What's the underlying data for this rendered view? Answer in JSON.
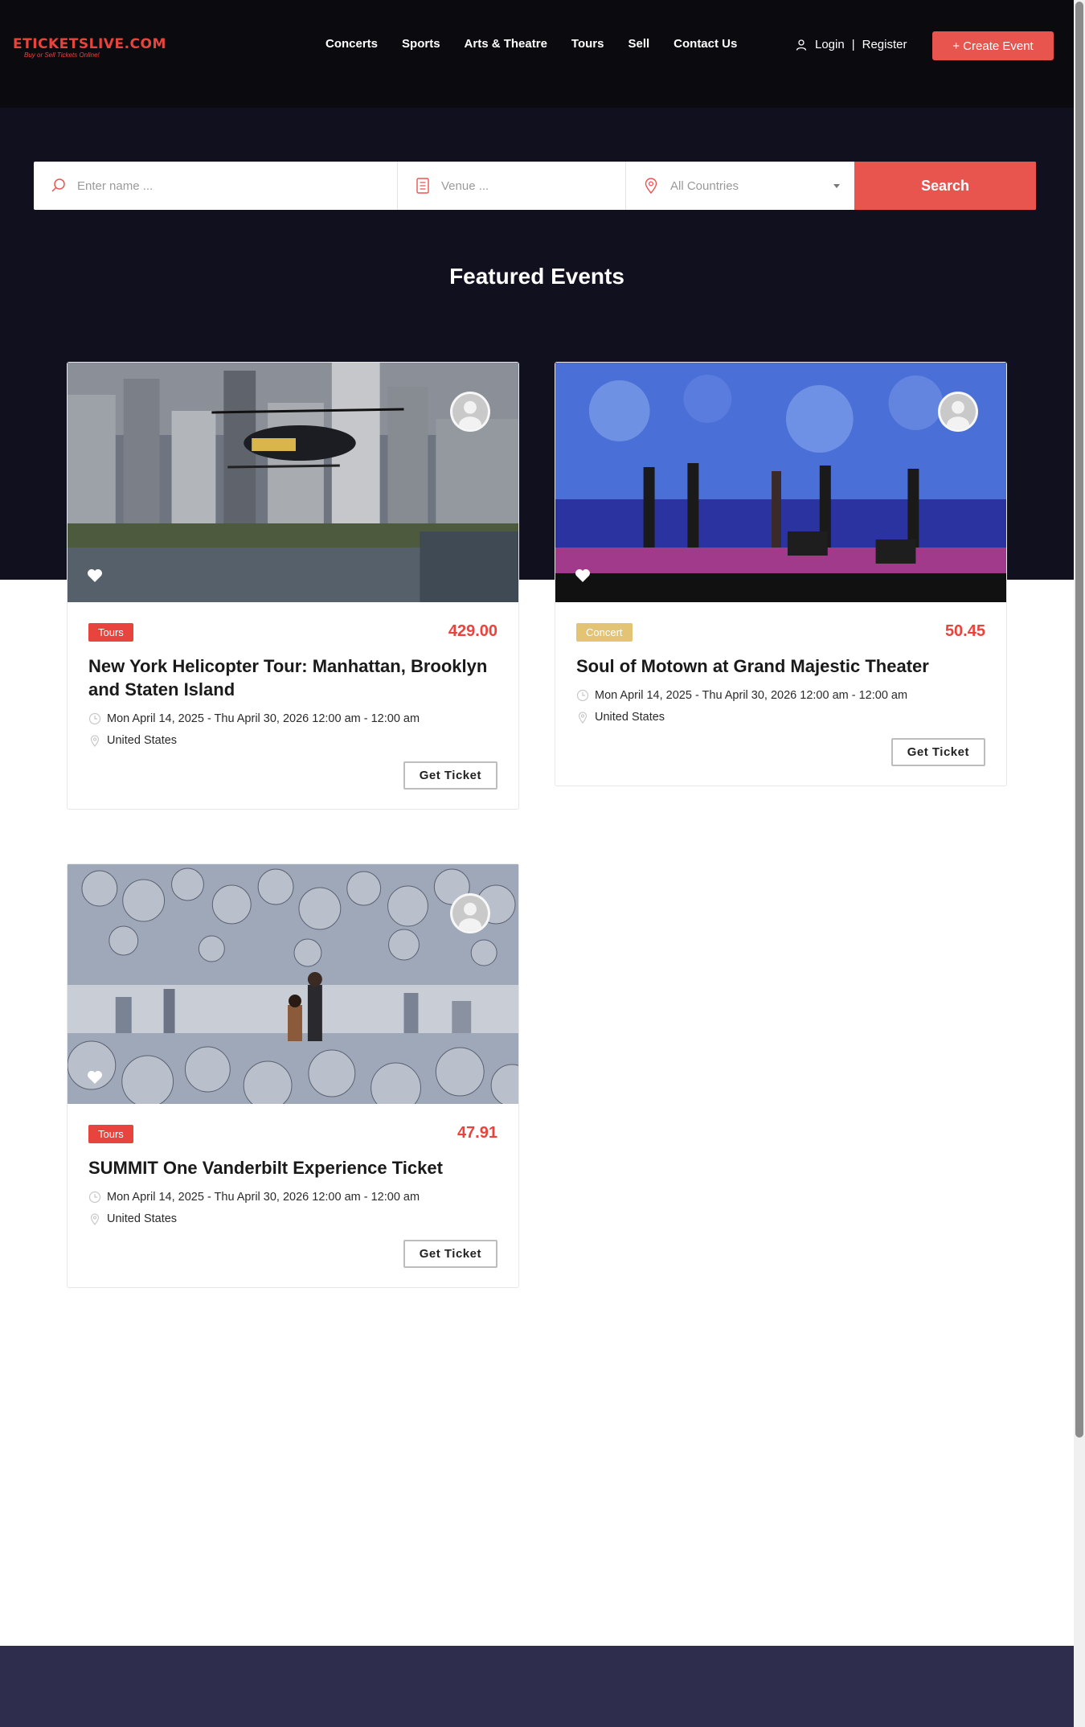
{
  "brand": {
    "name": "ETICKETSLIVE.COM",
    "tagline": "Buy or Sell Tickets Online!"
  },
  "nav": [
    "Concerts",
    "Sports",
    "Arts & Theatre",
    "Tours",
    "Sell",
    "Contact Us"
  ],
  "auth": {
    "login": "Login",
    "separator": "|",
    "register": "Register"
  },
  "create_event": "+ Create Event",
  "search": {
    "name_placeholder": "Enter name ...",
    "venue_placeholder": "Venue ...",
    "country_selected": "All Countries",
    "button": "Search"
  },
  "section_title": "Featured Events",
  "events": [
    {
      "category": "Tours",
      "price": "429.00",
      "title": "New York Helicopter Tour: Manhattan, Brooklyn and Staten Island",
      "dates": "Mon April 14, 2025 - Thu April 30, 2026 12:00 am - 12:00 am",
      "location": "United States",
      "button": "Get Ticket"
    },
    {
      "category": "Concert",
      "price": "50.45",
      "title": "Soul of Motown at Grand Majestic Theater",
      "dates": "Mon April 14, 2025 - Thu April 30, 2026 12:00 am - 12:00 am",
      "location": "United States",
      "button": "Get Ticket"
    },
    {
      "category": "Tours",
      "price": "47.91",
      "title": "SUMMIT One Vanderbilt Experience Ticket",
      "dates": "Mon April 14, 2025 - Thu April 30, 2026 12:00 am - 12:00 am",
      "location": "United States",
      "button": "Get Ticket"
    }
  ],
  "colors": {
    "accent": "#e8554e",
    "header_bg": "#0b0b0f",
    "hero_bg": "#11101f",
    "concert_tag": "#e3c474",
    "footer_bg": "#2e2d4e"
  },
  "icons": [
    "user-icon",
    "search-icon",
    "venue-icon",
    "location-pin-icon",
    "chevron-down-icon",
    "heart-icon",
    "clock-icon",
    "map-pin-icon"
  ]
}
